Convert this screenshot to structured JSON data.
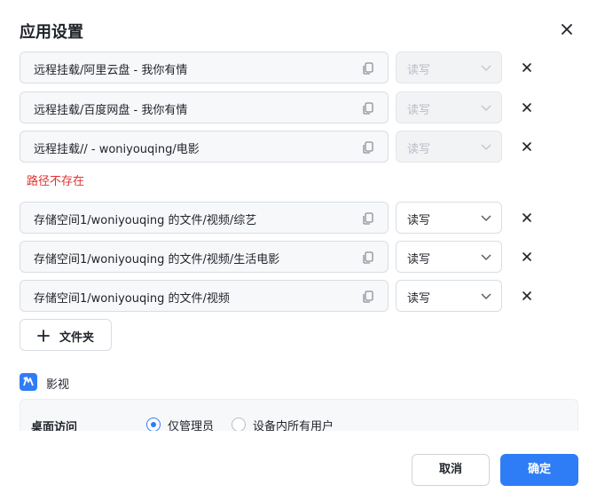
{
  "dialog": {
    "title": "应用设置",
    "close_icon": "close-icon"
  },
  "mounts": [
    {
      "path": "远程挂载/阿里云盘 - 我你有情",
      "permission": "读写",
      "disabled": true
    },
    {
      "path": "远程挂载/百度网盘 - 我你有情",
      "permission": "读写",
      "disabled": true
    },
    {
      "path": "远程挂载// - woniyouqing/电影",
      "permission": "读写",
      "disabled": true
    },
    {
      "path": "存储空间1/woniyouqing 的文件/视频/综艺",
      "permission": "读写",
      "disabled": false
    },
    {
      "path": "存储空间1/woniyouqing 的文件/视频/生活电影",
      "permission": "读写",
      "disabled": false
    },
    {
      "path": "存储空间1/woniyouqing 的文件/视频",
      "permission": "读写",
      "disabled": false
    }
  ],
  "error_text": "路径不存在",
  "add_folder_label": "文件夹",
  "app": {
    "name": "影视",
    "icon": "video-app-icon"
  },
  "access": {
    "label": "桌面访问",
    "options": [
      {
        "label": "仅管理员",
        "selected": true
      },
      {
        "label": "设备内所有用户",
        "selected": false
      }
    ]
  },
  "footer": {
    "cancel_label": "取消",
    "ok_label": "确定"
  },
  "colors": {
    "accent": "#2f7df6",
    "error": "#e03131"
  }
}
